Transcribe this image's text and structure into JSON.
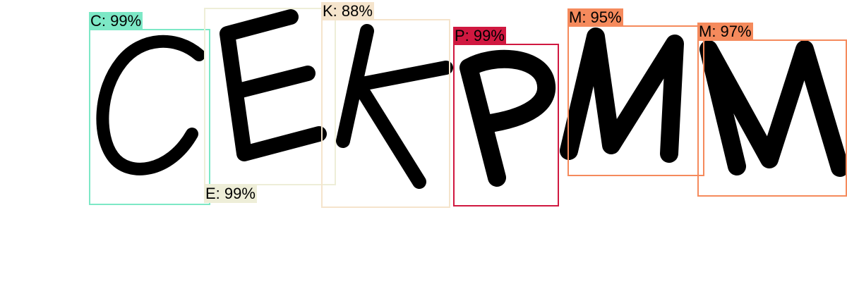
{
  "image": {
    "text": "CEKPMM"
  },
  "detections": [
    {
      "id": "c",
      "char": "C",
      "label": "C: 99%",
      "confidence": 0.99,
      "color": "#7de8c6",
      "label_text_color": "#000000"
    },
    {
      "id": "e",
      "char": "E",
      "label": "E: 99%",
      "confidence": 0.99,
      "color": "#eeeed8",
      "label_text_color": "#000000"
    },
    {
      "id": "k",
      "char": "K",
      "label": "K: 88%",
      "confidence": 0.88,
      "color": "#f5e4cc",
      "label_text_color": "#000000"
    },
    {
      "id": "p",
      "char": "P",
      "label": "P: 99%",
      "confidence": 0.99,
      "color": "#d01840",
      "label_text_color": "#000000"
    },
    {
      "id": "m1",
      "char": "M",
      "label": "M: 95%",
      "confidence": 0.95,
      "color": "#f58a5c",
      "label_text_color": "#000000"
    },
    {
      "id": "m2",
      "char": "M",
      "label": "M: 97%",
      "confidence": 0.97,
      "color": "#f58a5c",
      "label_text_color": "#000000"
    }
  ]
}
